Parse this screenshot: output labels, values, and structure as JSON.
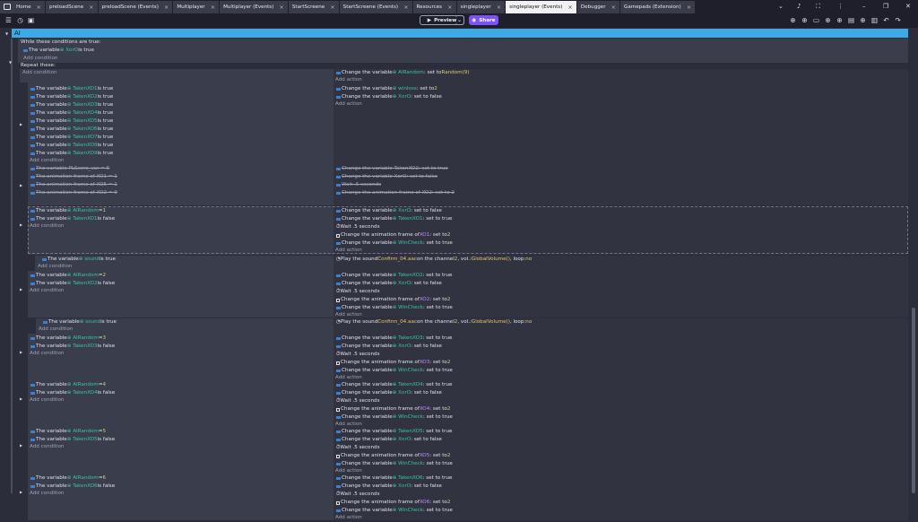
{
  "tabs": [
    {
      "label": "Home",
      "active": false
    },
    {
      "label": "preloadScene",
      "active": false
    },
    {
      "label": "preloadScene (Events)",
      "active": false
    },
    {
      "label": "Multiplayer",
      "active": false
    },
    {
      "label": "Multiplayer (Events)",
      "active": false
    },
    {
      "label": "StartScreene",
      "active": false
    },
    {
      "label": "StartScreene (Events)",
      "active": false
    },
    {
      "label": "Resources",
      "active": false
    },
    {
      "label": "singleplayer",
      "active": false
    },
    {
      "label": "singleplayer (Events)",
      "active": true
    },
    {
      "label": "Debugger",
      "active": false
    },
    {
      "label": "Gamepads (Extension)",
      "active": false
    }
  ],
  "tab_close": "×",
  "toolbar": {
    "preview_label": "Preview",
    "share_label": "Share"
  },
  "group": {
    "title": "AI"
  },
  "while": {
    "header": "While these conditions are true:",
    "condition": "The variable",
    "var": "XorO",
    "tail": "is true",
    "add_condition": "Add condition",
    "repeat": "Repeat these:"
  },
  "labels": {
    "add_condition": "Add condition",
    "add_action": "Add action"
  },
  "events": [
    {
      "conds": [],
      "acts": [
        {
          "t": "Change the variable ",
          "v": "AIRandom",
          "r": ": set to ",
          "n": "Random(9)"
        }
      ]
    },
    {
      "conds": [
        "TakenXO1",
        "TakenXO2",
        "TakenXO3",
        "TakenXO4",
        "TakenXO5",
        "TakenXO6",
        "TakenXO7",
        "TakenXO8",
        "TakenXO9"
      ],
      "acts": [
        {
          "t": "Change the variable ",
          "v": "winloss",
          "r": ": set to ",
          "n": "2"
        },
        {
          "t": "Change the variable ",
          "v": "XorO",
          "r": ": set to false",
          "n": ""
        }
      ]
    }
  ],
  "disabled": {
    "conds": [
      "The variable  PLScore_var  =  5",
      "The animation frame of     XO1  =  1",
      "The animation frame of     XO5  =  1",
      "The animation frame of     XO2  =  9"
    ],
    "acts": [
      "Change the variable  TakenXO2: set to true",
      "Change the variable  XorO: set to false",
      "Wait .5 seconds",
      "Change the animation frame of     XO2: set to 2"
    ]
  },
  "blocks": [
    {
      "n": "1",
      "taken": "TakenXO1",
      "frame": "XO1",
      "sound": false
    },
    {
      "n": "2",
      "taken": "TakenXO2",
      "frame": "XO2",
      "sound": true
    },
    {
      "n": "3",
      "taken": "TakenXO3",
      "frame": "XO3",
      "sound": true
    },
    {
      "n": "4",
      "taken": "TakenXO4",
      "frame": "XO4",
      "sound": false
    },
    {
      "n": "5",
      "taken": "TakenXO5",
      "frame": "XO5",
      "sound": false
    },
    {
      "n": "6",
      "taken": "TakenXO6",
      "frame": "XO6",
      "sound": false
    }
  ],
  "text": {
    "the_variable": "The variable",
    "airandom": "AIRandom",
    "eq": " = ",
    "is_false": " is false",
    "is_true": " is true",
    "sound_var": "sound",
    "change_var": "Change the variable ",
    "xoro": "XorO",
    "set_false": ": set to false",
    "set_true": ": set to true",
    "wait": "Wait .5 seconds",
    "change_anim": "Change the animation frame of ",
    "set_to": ": set to ",
    "two": "2",
    "wincheck": "WinCheck",
    "play_sound": "Play the sound ",
    "sound_file": "Confirm_04.aac",
    "sound_mid": " on the channel ",
    "sound_vol": ", vol.: ",
    "vol_fn": "GlobalVolume()",
    "loop": ", loop: ",
    "loop_val": "no"
  },
  "colors": {
    "accent": "#3fa9e5",
    "share": "#7d52f4",
    "var": "#3bc2a7",
    "number": "#e5c66a",
    "object": "#c686ff"
  }
}
